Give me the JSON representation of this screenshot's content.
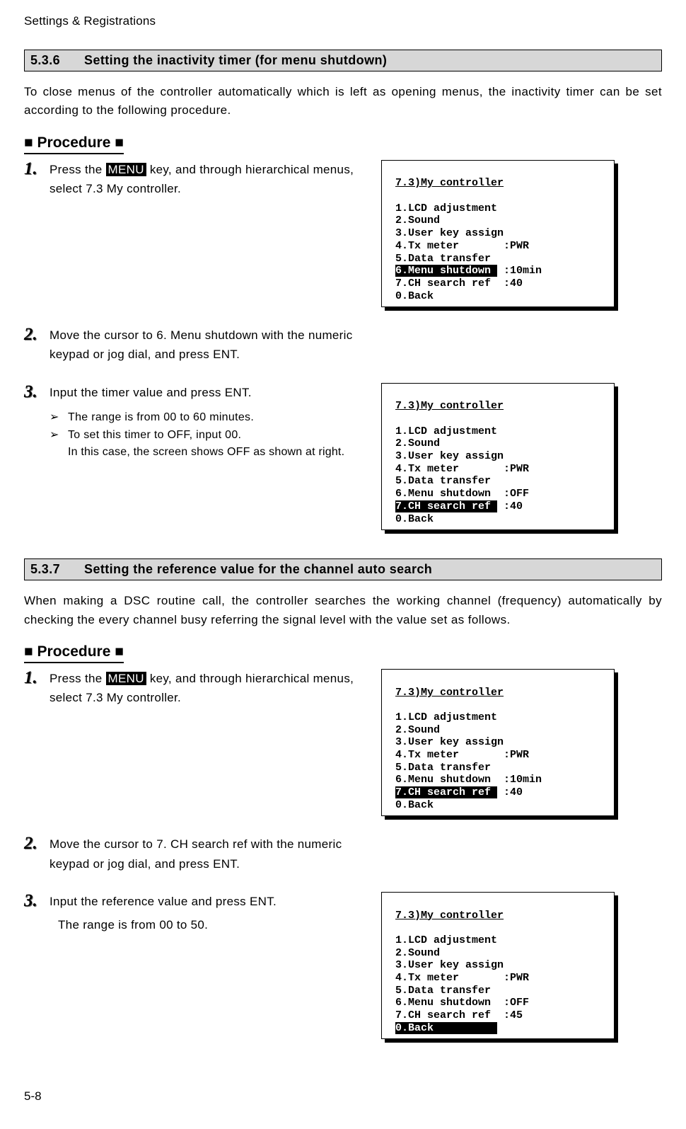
{
  "header": {
    "running": "Settings & Registrations"
  },
  "footer": {
    "page": "5-8"
  },
  "section1": {
    "num": "5.3.6",
    "title": "Setting the inactivity timer (for menu shutdown)",
    "intro": "To close menus of the controller automatically which is left as opening menus, the inactivity timer can be set according to the following procedure.",
    "procedure_label": "■ Procedure ■",
    "steps": {
      "s1": {
        "num": "1.",
        "pre": "Press the ",
        "key": "MENU",
        "post": " key, and through hierarchical menus, select 7.3 My controller."
      },
      "s2": {
        "num": "2.",
        "text": "Move the cursor to 6. Menu shutdown with the numeric keypad or jog dial, and press ENT."
      },
      "s3": {
        "num": "3.",
        "text": "Input the timer value and press ENT.",
        "b1": "The range is from 00 to 60 minutes.",
        "b2": "To set this timer to OFF, input 00.",
        "b3": "In this case, the screen shows OFF as shown at right."
      }
    },
    "lcd1": {
      "title": "7.3)My controller",
      "l1": "1.LCD adjustment",
      "l2": "2.Sound",
      "l3": "3.User key assign",
      "l4": "4.Tx meter       :PWR",
      "l5": "5.Data transfer",
      "l6a": "6.Menu shutdown ",
      "l6b": " :10min",
      "l7": "7.CH search ref  :40",
      "l8": "0.Back"
    },
    "lcd2": {
      "title": "7.3)My controller",
      "l1": "1.LCD adjustment",
      "l2": "2.Sound",
      "l3": "3.User key assign",
      "l4": "4.Tx meter       :PWR",
      "l5": "5.Data transfer",
      "l6": "6.Menu shutdown  :OFF",
      "l7a": "7.CH search ref ",
      "l7b": " :40",
      "l8": "0.Back"
    }
  },
  "section2": {
    "num": "5.3.7",
    "title": "Setting the reference value for the channel auto search",
    "intro": "When making a DSC routine call, the controller searches the working channel (frequency) automatically by checking the every channel busy referring the signal level with the value set as follows.",
    "procedure_label": "■ Procedure ■",
    "steps": {
      "s1": {
        "num": "1.",
        "pre": "Press the ",
        "key": "MENU",
        "post": " key, and through hierarchical menus, select 7.3 My controller."
      },
      "s2": {
        "num": "2.",
        "text": "Move the cursor to 7. CH search ref with the numeric keypad or jog dial, and press ENT."
      },
      "s3": {
        "num": "3.",
        "text": "Input the reference value and press ENT.",
        "note": "The range is from 00 to 50."
      }
    },
    "lcd1": {
      "title": "7.3)My controller",
      "l1": "1.LCD adjustment",
      "l2": "2.Sound",
      "l3": "3.User key assign",
      "l4": "4.Tx meter       :PWR",
      "l5": "5.Data transfer",
      "l6": "6.Menu shutdown  :10min",
      "l7a": "7.CH search ref ",
      "l7b": " :40",
      "l8": "0.Back"
    },
    "lcd2": {
      "title": "7.3)My controller",
      "l1": "1.LCD adjustment",
      "l2": "2.Sound",
      "l3": "3.User key assign",
      "l4": "4.Tx meter       :PWR",
      "l5": "5.Data transfer",
      "l6": "6.Menu shutdown  :OFF",
      "l7": "7.CH search ref  :45",
      "l8a": "0.Back          ",
      "l8b": ""
    }
  }
}
